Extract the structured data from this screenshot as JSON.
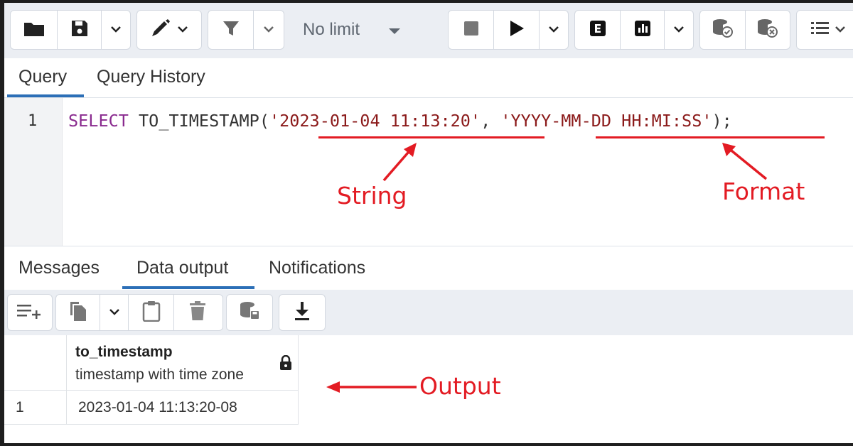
{
  "toolbar": {
    "limit_label": "No limit",
    "icons": [
      "folder-icon",
      "save-icon",
      "chevron-down-icon",
      "edit-pen-icon",
      "filter-icon",
      "stop-icon",
      "play-icon",
      "explain-icon",
      "explain-analyze-icon",
      "commit-icon",
      "rollback-icon",
      "macros-icon"
    ]
  },
  "query_tabs": [
    {
      "label": "Query",
      "active": true
    },
    {
      "label": "Query History",
      "active": false
    }
  ],
  "editor": {
    "line_number": "1",
    "keyword": "SELECT",
    "function": " TO_TIMESTAMP(",
    "arg1": "'2023-01-04 11:13:20'",
    "separator": ", ",
    "arg2": "'YYYY-MM-DD HH:MI:SS'",
    "end": ");"
  },
  "annotations": {
    "string_label": "String",
    "format_label": "Format",
    "output_label": "Output",
    "color": "#e31b23"
  },
  "result_tabs": [
    {
      "label": "Messages",
      "active": false
    },
    {
      "label": "Data output",
      "active": true
    },
    {
      "label": "Notifications",
      "active": false
    }
  ],
  "grid": {
    "column": {
      "name": "to_timestamp",
      "type": "timestamp with time zone"
    },
    "rows": [
      {
        "row_num": "1",
        "value": "2023-01-04 11:13:20-08"
      }
    ]
  },
  "colors": {
    "accent": "#2c6fb7",
    "toolbar_bg": "#ebeef3",
    "keyword": "#8a2b8f",
    "string": "#8b1a1a"
  }
}
